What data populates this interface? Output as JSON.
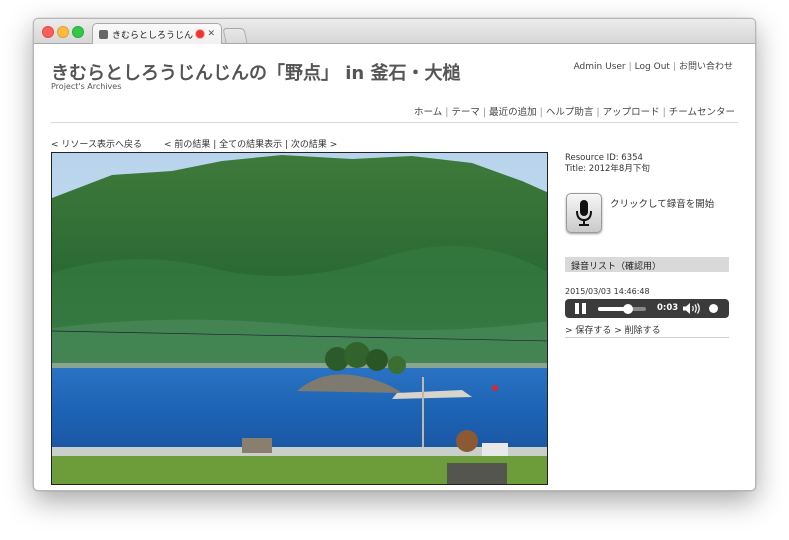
{
  "browser": {
    "tab_title": "きむらとしろうじんじん"
  },
  "header": {
    "title": "きむらとしろうじんじんの「野点」 in 釜石・大槌",
    "subtitle": "Project's Archives",
    "user_nav": [
      "Admin User",
      "Log Out",
      "お問い合わせ"
    ],
    "main_nav": [
      "ホーム",
      "テーマ",
      "最近の追加",
      "ヘルプ助言",
      "アップロード",
      "チームセンター"
    ]
  },
  "resource_nav": {
    "back": "< リソース表示へ戻る",
    "prev": "< 前の結果",
    "all": "全ての結果表示",
    "next": "次の結果 >"
  },
  "resource": {
    "id_line": "Resource ID: 6354",
    "title_line": "Title: 2012年8月下旬"
  },
  "recorder": {
    "record_label": "クリックして録音を開始",
    "list_header": "録音リスト（確認用）",
    "items": [
      {
        "timestamp": "2015/03/03 14:46:48",
        "time": "0:03",
        "progress": 0.62,
        "save": "> 保存する",
        "delete": "> 削除する"
      }
    ]
  },
  "colors": {
    "sky": "#c6def0",
    "mountain": "#2e6b34",
    "sea": "#1f64b5",
    "player_bg": "#3b3b3b"
  },
  "icons": {
    "record_button": "microphone-icon",
    "play_state": "pause-icon",
    "volume": "volume-icon"
  }
}
